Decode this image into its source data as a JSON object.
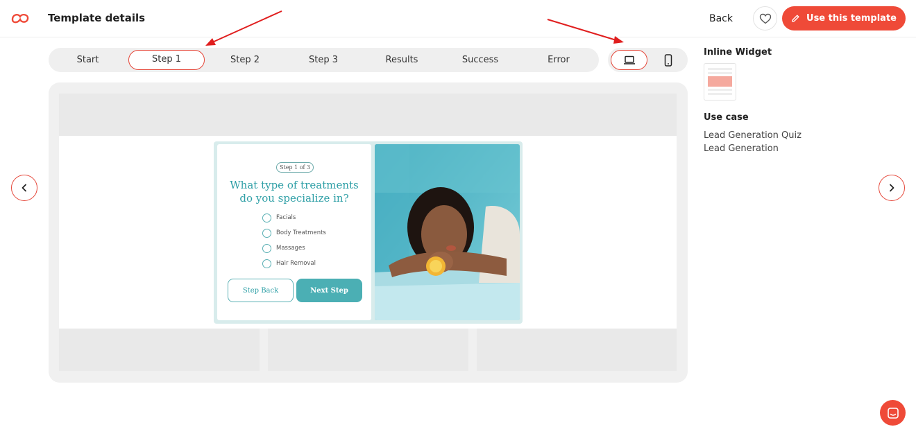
{
  "header": {
    "title": "Template details",
    "back_label": "Back",
    "use_template_label": "Use this template"
  },
  "steps": [
    "Start",
    "Step 1",
    "Step 2",
    "Step 3",
    "Results",
    "Success",
    "Error"
  ],
  "active_step": "Step 1",
  "devices": [
    {
      "icon": "laptop-icon",
      "active": true
    },
    {
      "icon": "phone-icon",
      "active": false
    }
  ],
  "widget": {
    "step_indicator": "Step 1 of 3",
    "question_line1": "What type of treatments",
    "question_line2": "do you specialize in?",
    "options": [
      "Facials",
      "Body Treatments",
      "Massages",
      "Hair Removal"
    ],
    "back_button": "Step Back",
    "next_button": "Next Step"
  },
  "sidebar": {
    "type_heading": "Inline Widget",
    "use_case_heading": "Use case",
    "use_cases": [
      "Lead Generation Quiz",
      "Lead Generation"
    ]
  },
  "colors": {
    "brand": "#ef4a38",
    "teal": "#4bafb4",
    "annotation_arrow": "#e01e1e"
  }
}
